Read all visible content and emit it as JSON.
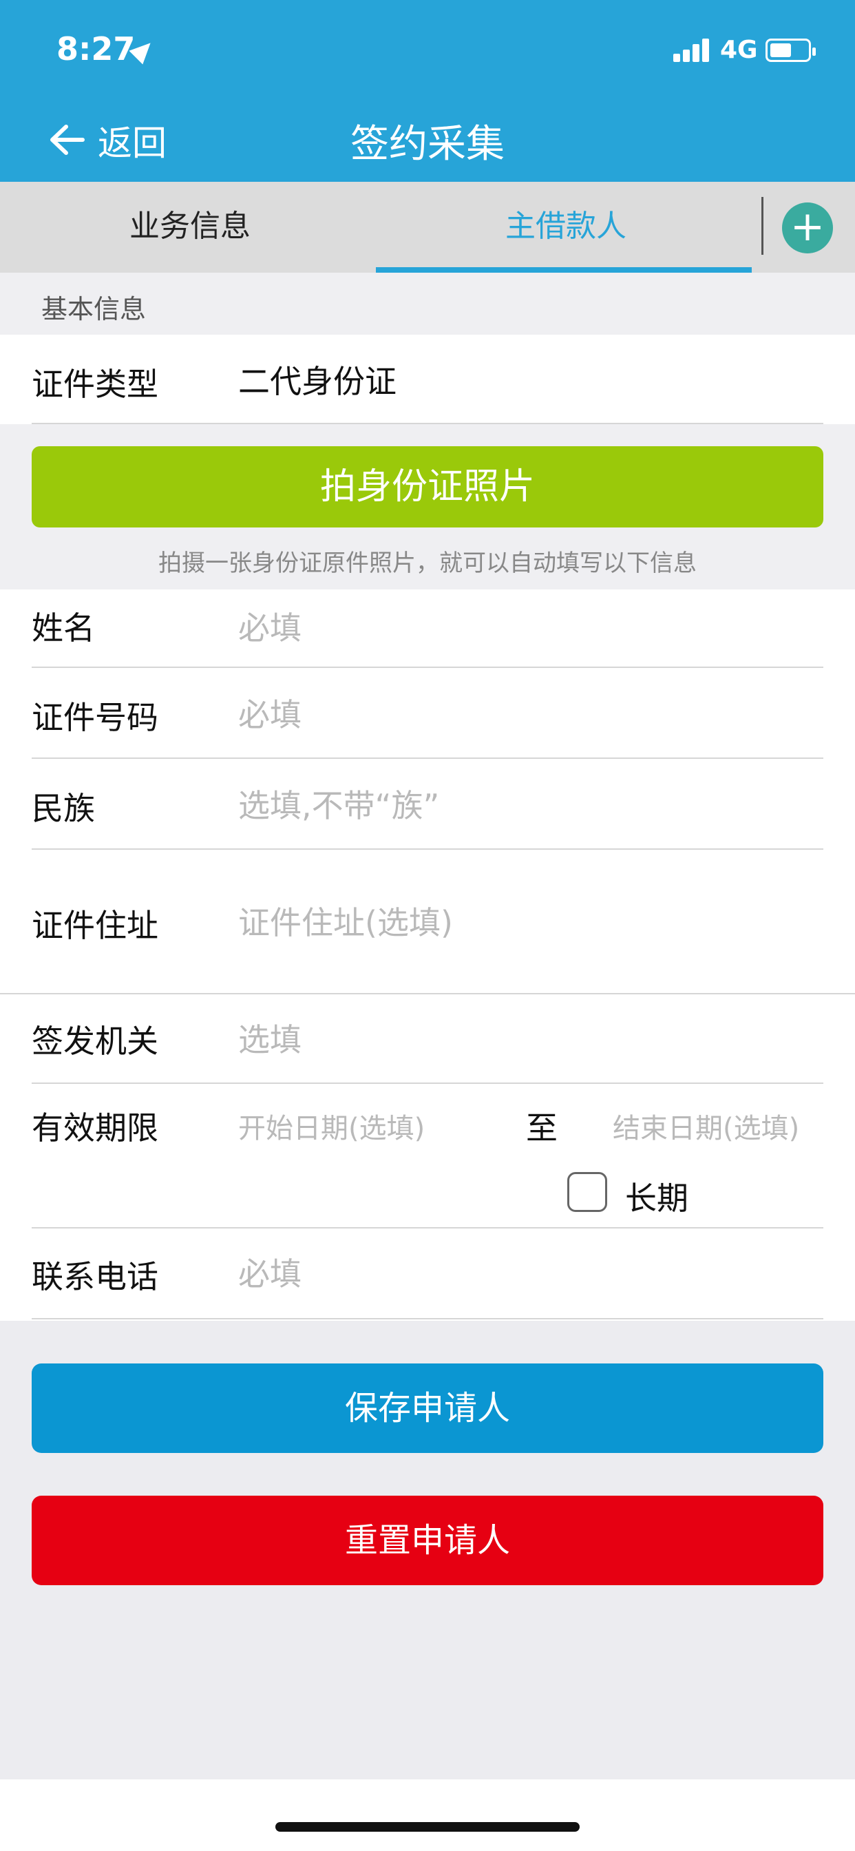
{
  "status_bar": {
    "time": "8:27",
    "network": "4G",
    "icons": [
      "location-arrow-icon",
      "signal-bars-icon",
      "battery-icon"
    ]
  },
  "nav": {
    "back_label": "返回",
    "title": "签约采集",
    "back_icon": "back-arrow-icon"
  },
  "tabs": [
    {
      "label": "业务信息",
      "selected": false
    },
    {
      "label": "主借款人",
      "selected": true
    }
  ],
  "add_button": {
    "icon": "plus-icon",
    "symbol": "+"
  },
  "section_header": "基本信息",
  "id_type": {
    "label": "证件类型",
    "value": "二代身份证"
  },
  "photo_button": {
    "label": "拍身份证照片"
  },
  "photo_hint": "拍摄一张身份证原件照片，就可以自动填写以下信息",
  "fields": {
    "name": {
      "label": "姓名",
      "placeholder": "必填"
    },
    "id_number": {
      "label": "证件号码",
      "placeholder": "必填"
    },
    "ethnicity": {
      "label": "民族",
      "placeholder": "选填,不带“族”"
    },
    "address": {
      "label": "证件住址",
      "placeholder": "证件住址(选填)"
    },
    "issuer": {
      "label": "签发机关",
      "placeholder": "选填"
    },
    "validity": {
      "label": "有效期限",
      "start_placeholder": "开始日期(选填)",
      "separator": "至",
      "end_placeholder": "结束日期(选填)",
      "long_term_label": "长期",
      "long_term_checked": false
    },
    "phone": {
      "label": "联系电话",
      "placeholder": "必填"
    }
  },
  "buttons": {
    "save": "保存申请人",
    "reset": "重置申请人"
  },
  "colors": {
    "header_blue": "#27a4d8",
    "photo_green": "#9ac90a",
    "save_blue": "#0b96d2",
    "reset_red": "#e60012",
    "add_teal": "#3aab9f"
  }
}
